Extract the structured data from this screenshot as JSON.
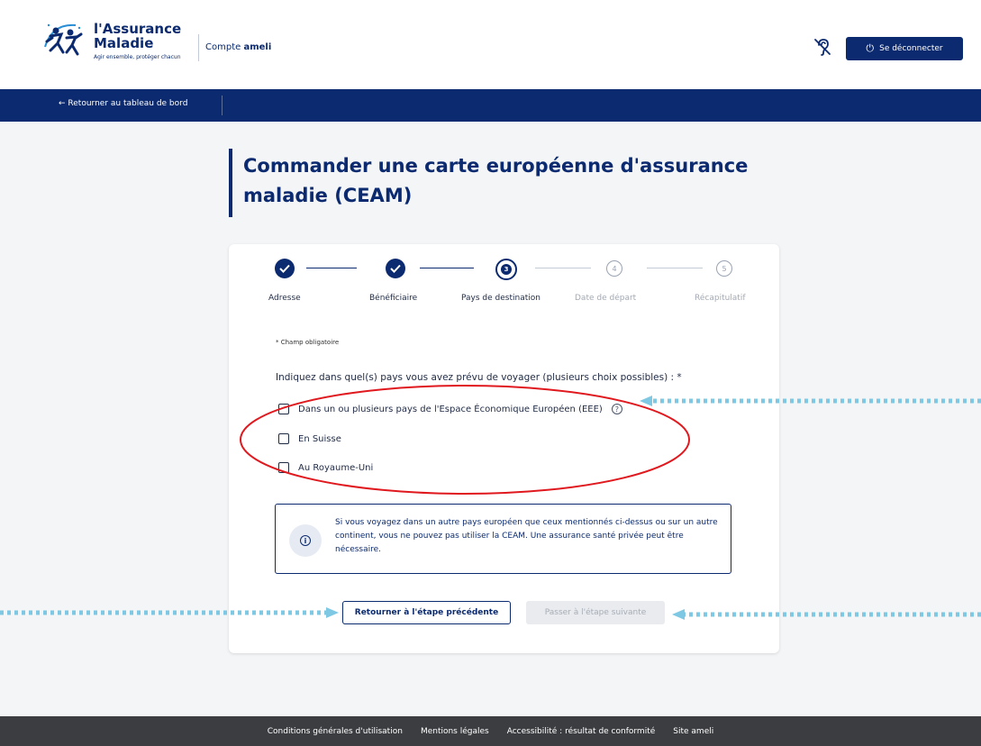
{
  "header": {
    "logo_line1": "l'Assurance",
    "logo_line2": "Maladie",
    "logo_tagline": "Agir ensemble, protéger chacun",
    "compte_prefix": "Compte",
    "compte_name": "ameli",
    "logout_label": "Se déconnecter"
  },
  "nav": {
    "back_label": "← Retourner au tableau de bord"
  },
  "page": {
    "title": "Commander une carte européenne d'assurance maladie (CEAM)"
  },
  "stepper": {
    "steps": [
      {
        "label": "Adresse",
        "state": "done"
      },
      {
        "label": "Bénéficiaire",
        "state": "done"
      },
      {
        "label": "Pays de destination",
        "state": "current",
        "number": "3"
      },
      {
        "label": "Date de départ",
        "state": "future",
        "number": "4"
      },
      {
        "label": "Récapitulatif",
        "state": "future",
        "number": "5"
      }
    ]
  },
  "form": {
    "required_note": "* Champ obligatoire",
    "question": "Indiquez dans quel(s) pays vous avez prévu de voyager (plusieurs choix possibles) : *",
    "options": [
      {
        "label": "Dans un ou plusieurs pays de l'Espace Économique Européen (EEE)",
        "checked": false,
        "help": "?"
      },
      {
        "label": "En Suisse",
        "checked": false
      },
      {
        "label": "Au Royaume-Uni",
        "checked": false
      }
    ],
    "info_icon": "i",
    "info_text": "Si vous voyagez dans un autre pays européen que ceux mentionnés ci-dessus ou sur un autre continent, vous ne pouvez pas utiliser la CEAM. Une assurance santé privée peut être nécessaire.",
    "btn_prev": "Retourner à l'étape précédente",
    "btn_next": "Passer à l'étape suivante"
  },
  "footer": {
    "links": [
      "Conditions générales d'utilisation",
      "Mentions légales",
      "Accessibilité : résultat de conformité",
      "Site ameli"
    ]
  },
  "colors": {
    "brand": "#0b2a6f",
    "annotation_red": "#e0191f",
    "annotation_dots": "#7ec8e3",
    "footer_bg": "#3b3d40"
  },
  "icons": [
    "logo-figures-icon",
    "hearing-icon",
    "power-icon",
    "check-icon",
    "help-icon",
    "info-icon"
  ]
}
